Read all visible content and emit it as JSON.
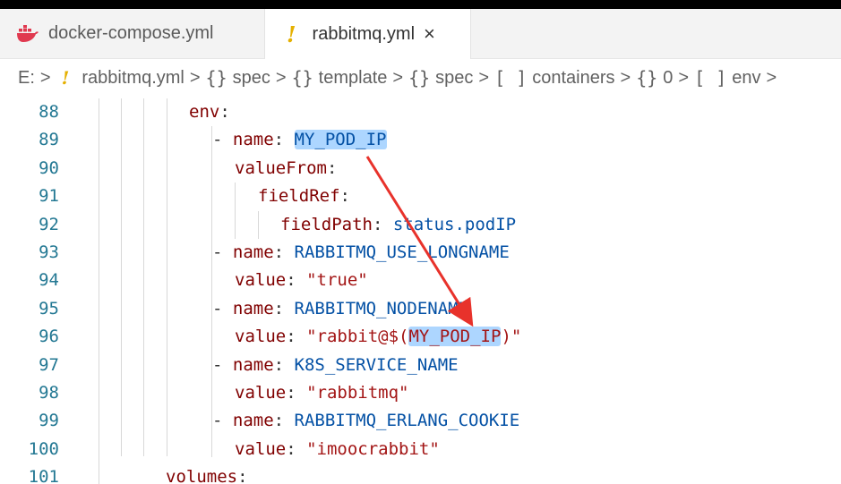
{
  "tabs": [
    {
      "label": "docker-compose.yml",
      "icon": "docker-icon",
      "active": false
    },
    {
      "label": "rabbitmq.yml",
      "icon": "yaml-warning-icon",
      "active": true,
      "close": "×"
    }
  ],
  "breadcrumb": [
    {
      "label": "E:",
      "icon": ""
    },
    {
      "label": "rabbitmq.yml",
      "icon": "!"
    },
    {
      "label": "spec",
      "icon": "{}"
    },
    {
      "label": "template",
      "icon": "{}"
    },
    {
      "label": "spec",
      "icon": "{}"
    },
    {
      "label": "containers",
      "icon": "[ ]"
    },
    {
      "label": "0",
      "icon": "{}"
    },
    {
      "label": "env",
      "icon": "[ ]"
    }
  ],
  "breadcrumb_separator": ">",
  "lines": [
    {
      "num": "88",
      "key": "env",
      "colon": ":"
    },
    {
      "num": "89",
      "dash": "- ",
      "key": "name",
      "colon": ": ",
      "value": "MY_POD_IP"
    },
    {
      "num": "90",
      "key": "valueFrom",
      "colon": ":"
    },
    {
      "num": "91",
      "key": "fieldRef",
      "colon": ":"
    },
    {
      "num": "92",
      "key": "fieldPath",
      "colon": ": ",
      "value": "status.podIP"
    },
    {
      "num": "93",
      "dash": "- ",
      "key": "name",
      "colon": ": ",
      "value": "RABBITMQ_USE_LONGNAME"
    },
    {
      "num": "94",
      "key": "value",
      "colon": ": ",
      "string": "\"true\""
    },
    {
      "num": "95",
      "dash": "- ",
      "key": "name",
      "colon": ": ",
      "value": "RABBITMQ_NODENAME"
    },
    {
      "num": "96",
      "key": "value",
      "colon": ": ",
      "string_pre": "\"rabbit@$(",
      "string_hl": "MY_POD_IP",
      "string_post": ")\""
    },
    {
      "num": "97",
      "dash": "- ",
      "key": "name",
      "colon": ": ",
      "value": "K8S_SERVICE_NAME"
    },
    {
      "num": "98",
      "key": "value",
      "colon": ": ",
      "string": "\"rabbitmq\""
    },
    {
      "num": "99",
      "dash": "- ",
      "key": "name",
      "colon": ": ",
      "value": "RABBITMQ_ERLANG_COOKIE"
    },
    {
      "num": "100",
      "key": "value",
      "colon": ": ",
      "string": "\"imoocrabbit\""
    },
    {
      "num": "101",
      "key": "volumes",
      "colon": ":"
    }
  ],
  "colors": {
    "line_number": "#237893",
    "key": "#800000",
    "value": "#0451a5",
    "string": "#a31515",
    "highlight": "#add6ff",
    "arrow": "#e8322b",
    "yaml_icon": "#e5b000",
    "docker_icon": "#e0394f"
  }
}
